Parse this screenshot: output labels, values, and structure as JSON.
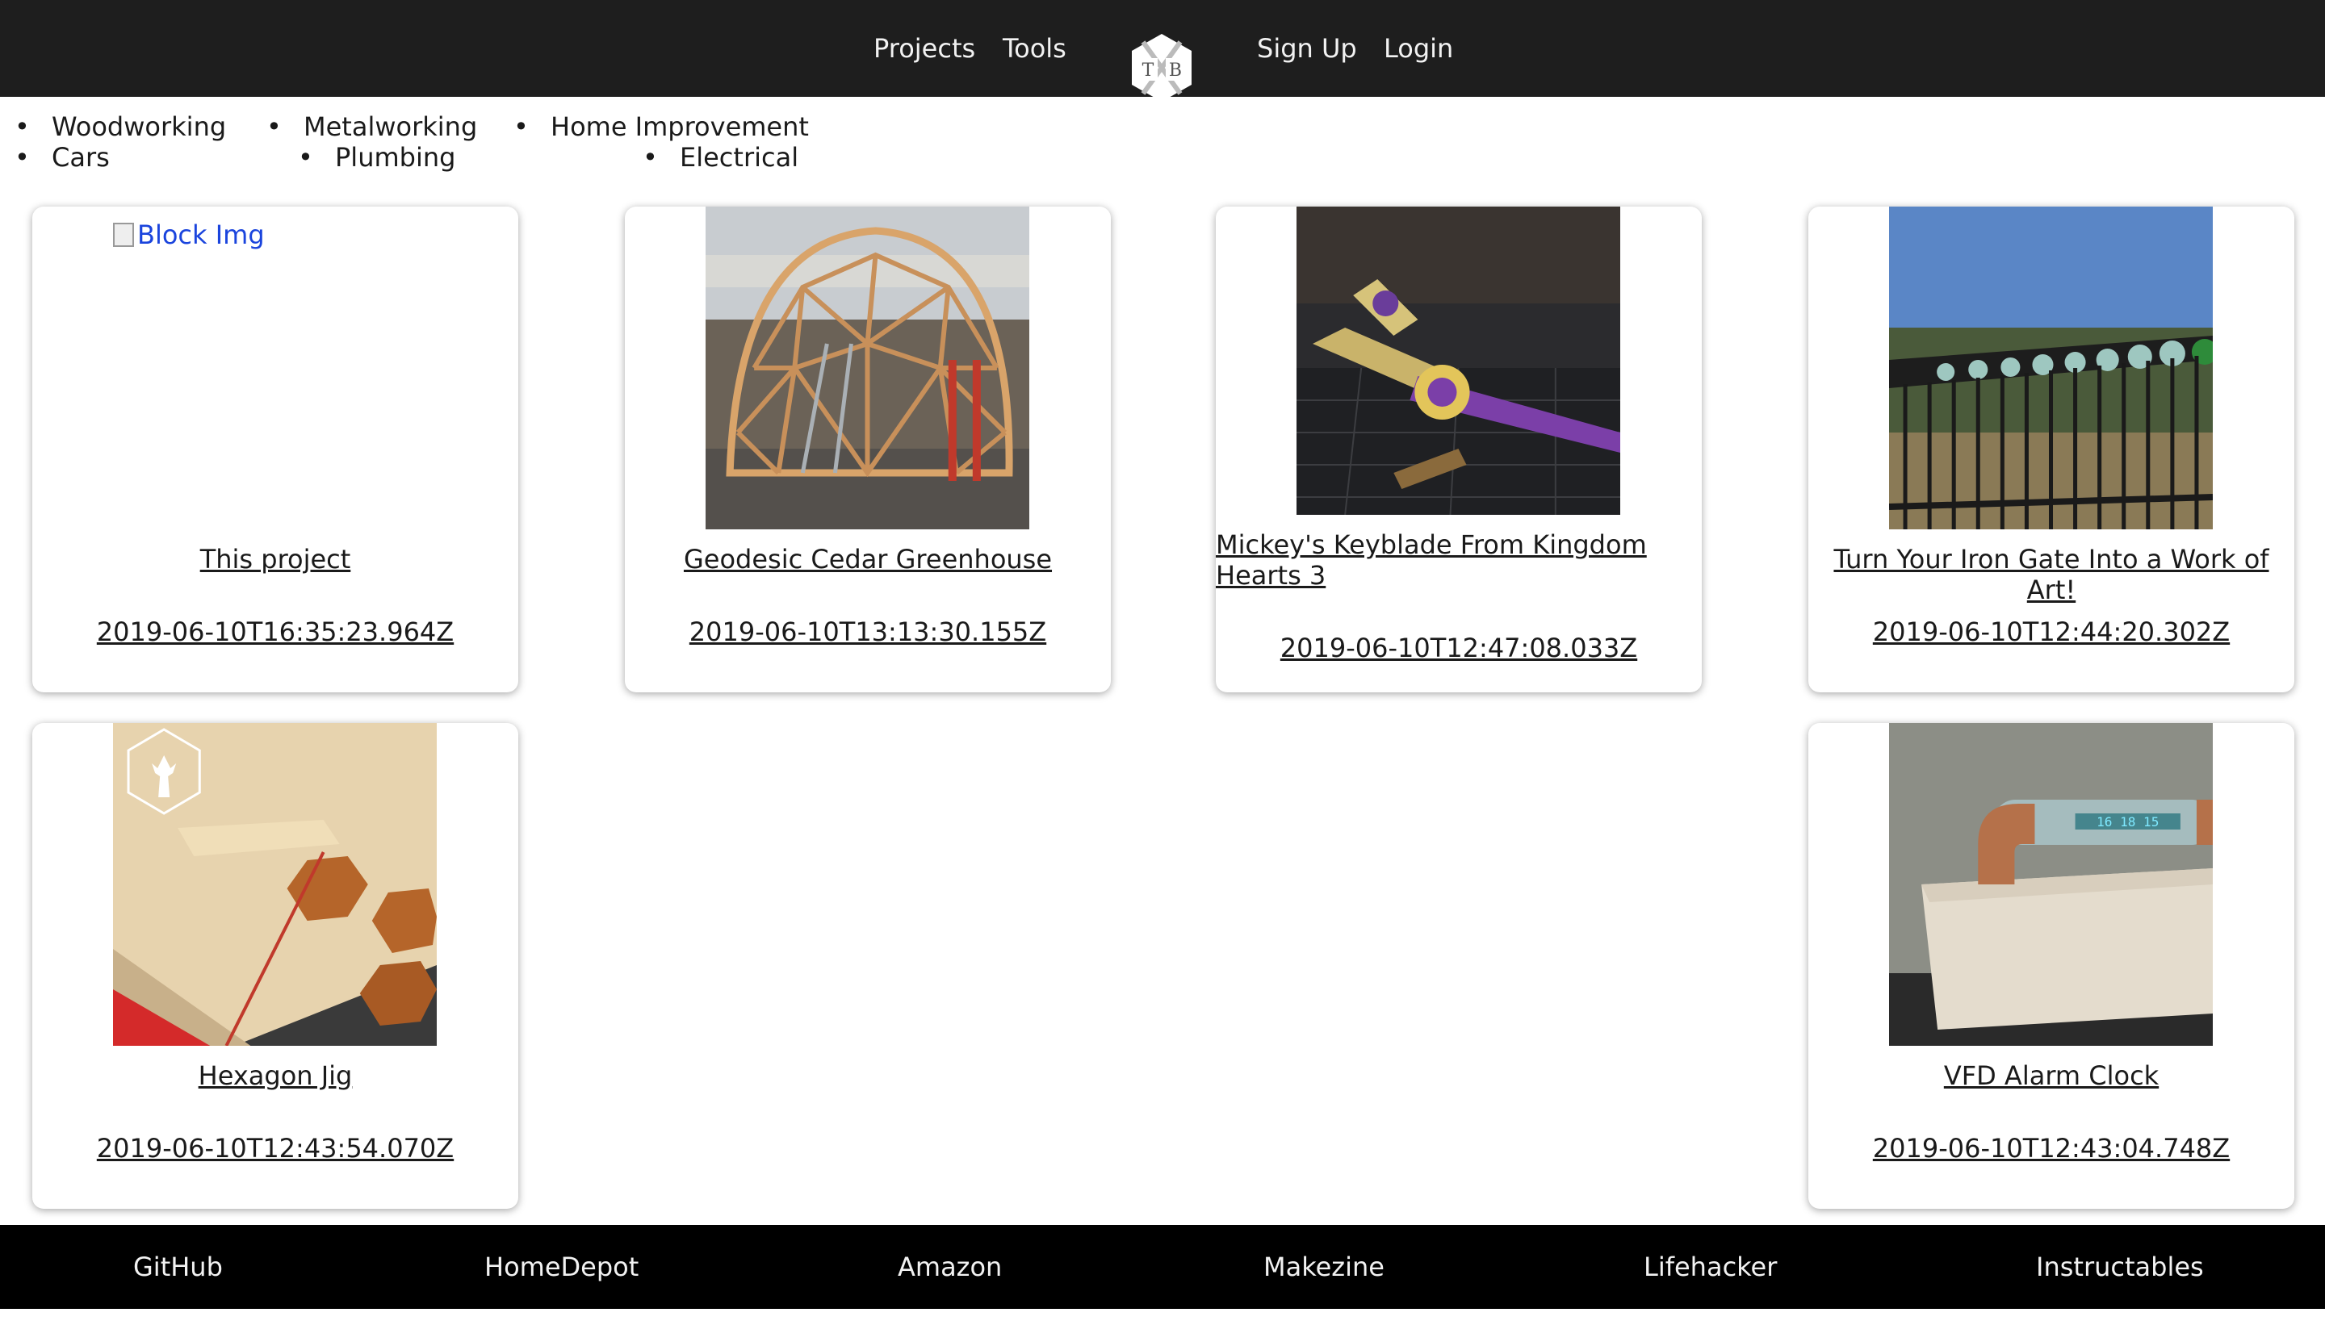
{
  "nav": {
    "projects_label": "Projects",
    "tools_label": "Tools",
    "logo_letters": "T B",
    "signup_label": "Sign Up",
    "login_label": "Login"
  },
  "categories": {
    "col1": [
      "Woodworking",
      "Cars"
    ],
    "col2": [
      "Metalworking",
      "Plumbing"
    ],
    "col3": [
      "Home Improvement",
      "Electrical"
    ]
  },
  "projects": [
    {
      "title": "This project",
      "date": "2019-06-10T16:35:23.964Z",
      "image_alt": "Block Img",
      "image": "broken"
    },
    {
      "title": "Geodesic Cedar Greenhouse",
      "date": "2019-06-10T13:13:30.155Z",
      "image": "geodesic-dome-photo"
    },
    {
      "title": "Mickey's Keyblade From Kingdom Hearts 3",
      "date": "2019-06-10T12:47:08.033Z",
      "image": "keyblade-photo"
    },
    {
      "title": "Turn Your Iron Gate Into a Work of Art!",
      "date": "2019-06-10T12:44:20.302Z",
      "image": "iron-gate-photo"
    },
    {
      "title": "Hexagon Jig",
      "date": "2019-06-10T12:43:54.070Z",
      "image": "hexagon-jig-photo"
    },
    {
      "title": "VFD Alarm Clock",
      "date": "2019-06-10T12:43:04.748Z",
      "image": "vfd-clock-photo",
      "clock_digits": "16 18 15"
    }
  ],
  "footer": {
    "links": [
      "GitHub",
      "HomeDepot",
      "Amazon",
      "Makezine",
      "Lifehacker",
      "Instructables"
    ]
  },
  "colors": {
    "nav_bg": "#1e1e1e",
    "footer_bg": "#000000",
    "link_text": "#1a1a1a",
    "broken_link_blue": "#1a44dd"
  }
}
